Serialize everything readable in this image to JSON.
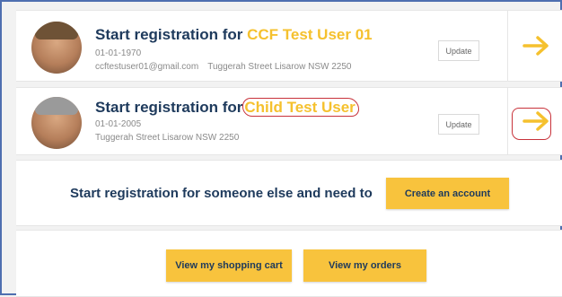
{
  "users": [
    {
      "title_prefix": "Start registration for ",
      "name": "CCF Test User 01",
      "dob": "01-01-1970",
      "email": "ccftestuser01@gmail.com",
      "address": "Tuggerah Street Lisarow NSW 2250",
      "update_label": "Update",
      "arrow_icon": "arrow-right-icon"
    },
    {
      "title_prefix": "Start registration for",
      "name": "Child Test User",
      "dob": "01-01-2005",
      "address": "Tuggerah Street Lisarow NSW 2250",
      "update_label": "Update",
      "arrow_icon": "arrow-right-icon"
    }
  ],
  "someone_else": {
    "text": "Start registration for someone else and need to",
    "create_label": "Create an account"
  },
  "footer": {
    "cart_label": "View my shopping cart",
    "orders_label": "View my orders"
  },
  "colors": {
    "accent_yellow": "#f8c33d",
    "name_yellow": "#f5c12e",
    "navy": "#1e3a5c",
    "annotation_red": "#c8323a",
    "frame_blue": "#4f6fb0"
  }
}
